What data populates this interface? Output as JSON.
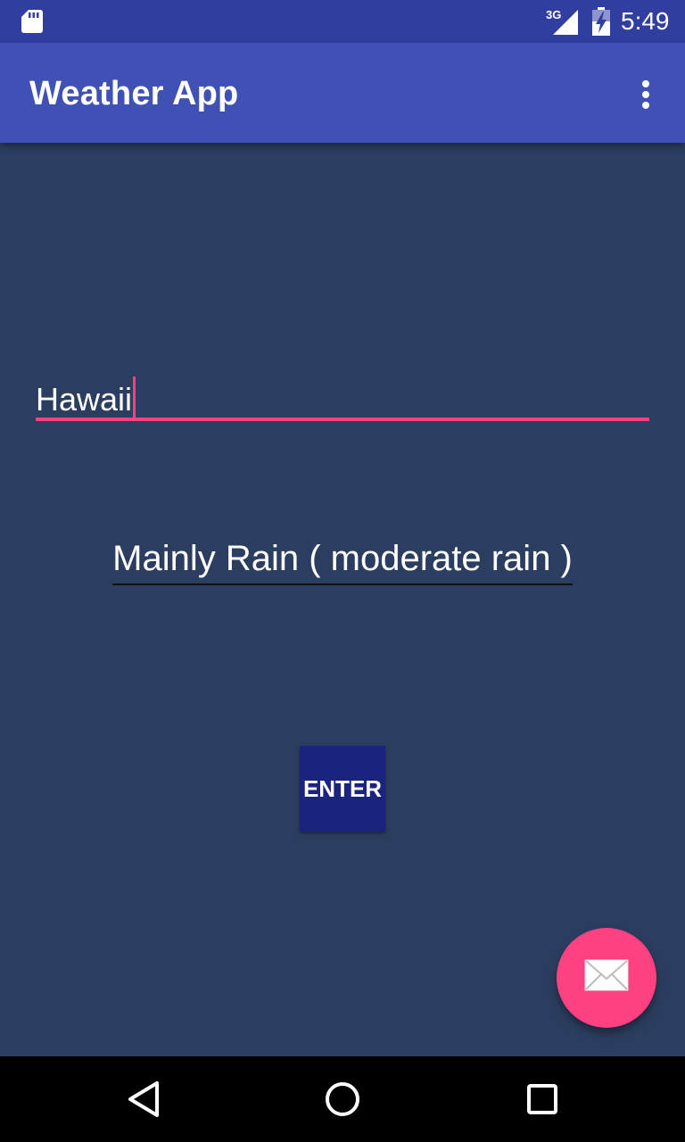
{
  "status_bar": {
    "network_label": "3G",
    "time": "5:49",
    "icons": [
      "sd-card-icon",
      "signal-icon",
      "battery-charging-icon"
    ]
  },
  "app_bar": {
    "title": "Weather App",
    "overflow_icon": "more-vert-icon"
  },
  "city_input": {
    "value": "Hawaii",
    "accent_color": "#ff4081"
  },
  "weather": {
    "description": "Mainly Rain ( moderate rain )"
  },
  "enter_button": {
    "label": "ENTER"
  },
  "fab": {
    "icon": "mail-icon"
  },
  "nav_bar": {
    "icons": [
      "back-icon",
      "home-icon",
      "recents-icon"
    ]
  },
  "colors": {
    "status_bar": "#303f9f",
    "app_bar": "#3f51b5",
    "background": "#2c3e60",
    "accent": "#ff4081",
    "button": "#1a237e"
  }
}
